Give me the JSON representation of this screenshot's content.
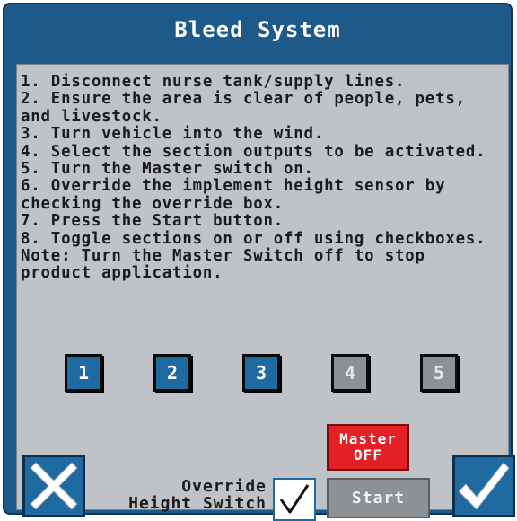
{
  "window": {
    "title": "Bleed System"
  },
  "instructions": [
    "1. Disconnect nurse tank/supply lines.",
    "2. Ensure the area is clear of people, pets, and livestock.",
    "3. Turn vehicle into the wind.",
    "4. Select the section outputs to be activated.",
    "5. Turn the Master switch on.",
    "6. Override the implement height sensor by checking the override box.",
    "7. Press the Start button.",
    "8. Toggle sections on or off using checkboxes.",
    "Note: Turn the Master Switch off to stop product application."
  ],
  "sections": [
    {
      "label": "1",
      "state": "active"
    },
    {
      "label": "2",
      "state": "active"
    },
    {
      "label": "3",
      "state": "active"
    },
    {
      "label": "4",
      "state": "inactive"
    },
    {
      "label": "5",
      "state": "inactive"
    }
  ],
  "master": {
    "line1": "Master",
    "line2": "OFF",
    "color": "#e32026"
  },
  "start": {
    "label": "Start"
  },
  "override": {
    "line1": "Override",
    "line2": "Height Switch",
    "checked": true
  },
  "icons": {
    "cancel": "close-icon",
    "accept": "checkmark-icon",
    "override": "checkmark-icon"
  },
  "colors": {
    "frame": "#1d5a8a",
    "panel": "#bfc3c7",
    "active": "#1e6aa1",
    "inactive": "#8e9193"
  }
}
